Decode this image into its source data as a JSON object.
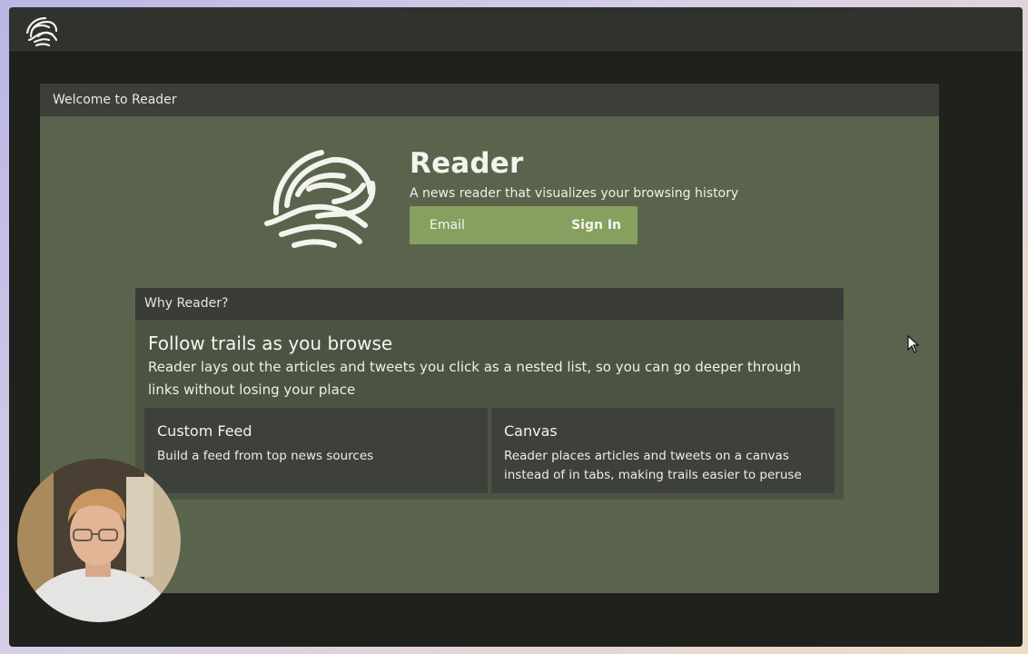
{
  "app": {
    "logo_icon": "brain-logo-icon"
  },
  "welcome": {
    "header": "Welcome to Reader",
    "title": "Reader",
    "subtitle": "A news reader that visualizes your browsing history",
    "email_placeholder": "Email",
    "signin_label": "Sign In"
  },
  "why": {
    "header": "Why Reader?",
    "heading": "Follow trails as you browse",
    "description": "Reader lays out the articles and tweets you click as a nested list, so you can go deeper through links without losing your place",
    "cards": [
      {
        "title": "Custom Feed",
        "description": "Build a feed from top news sources"
      },
      {
        "title": "Canvas",
        "description": "Reader places articles and tweets on a canvas instead of in tabs, making trails easier to peruse"
      }
    ]
  },
  "colors": {
    "panel": "#5a644c",
    "button": "#87a05f",
    "header": "#3c3f38"
  }
}
